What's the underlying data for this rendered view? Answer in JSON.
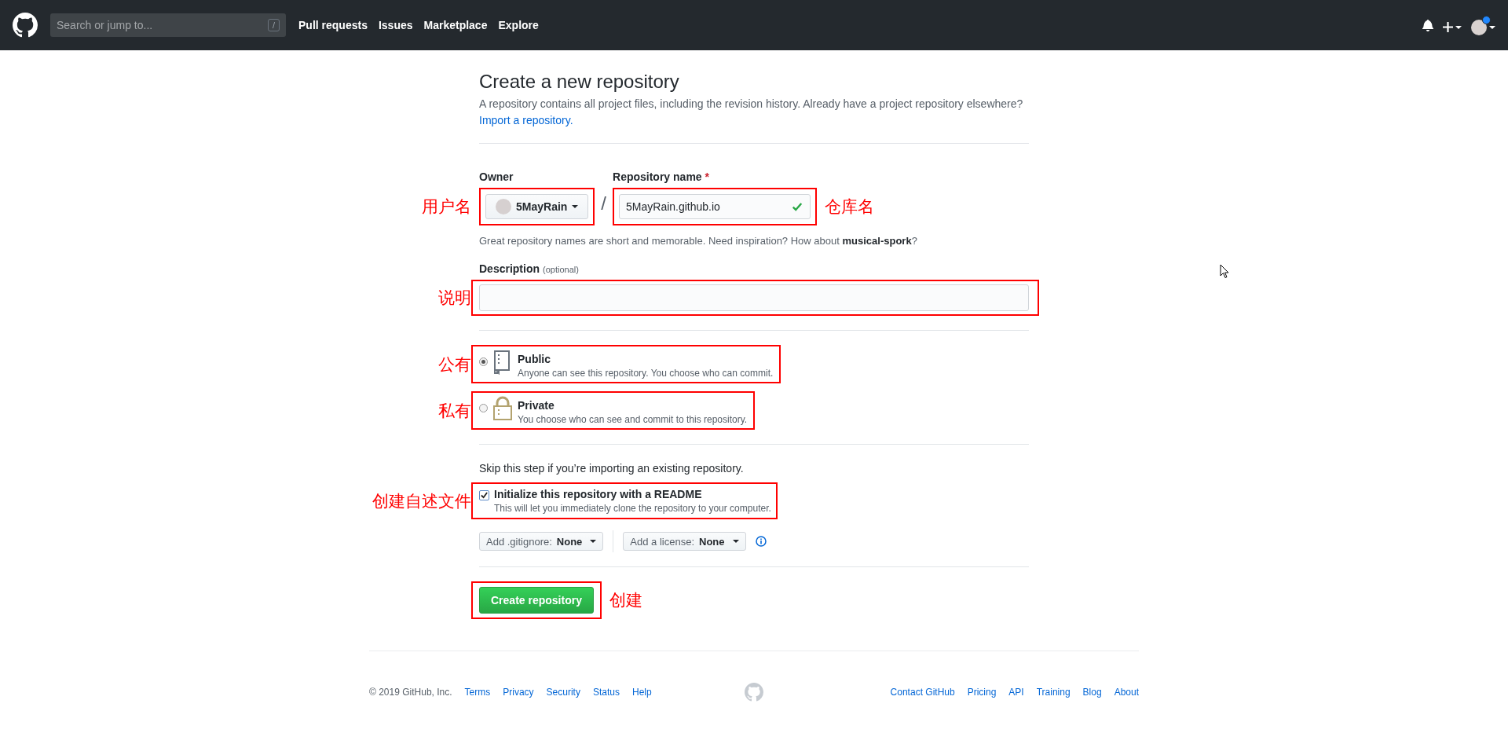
{
  "header": {
    "search": {
      "placeholder": "Search or jump to...",
      "shortcut": "/"
    },
    "nav": [
      "Pull requests",
      "Issues",
      "Marketplace",
      "Explore"
    ]
  },
  "page": {
    "title": "Create a new repository",
    "intro": "A repository contains all project files, including the revision history. Already have a project repository elsewhere?",
    "import_link": "Import a repository."
  },
  "owner": {
    "label": "Owner",
    "value": "5MayRain",
    "annotation": "用户名"
  },
  "owner_separator": "/",
  "repository_name": {
    "label": "Repository name",
    "required_mark": "*",
    "value": "5MayRain.github.io",
    "valid": true,
    "annotation": "仓库名"
  },
  "name_hint": "Great repository names are short and memorable. Need inspiration? How about **musical-spork**?",
  "description": {
    "label": "Description",
    "optional": "(optional)",
    "annotation": "说明"
  },
  "visibility": [
    {
      "kind": "public",
      "title": "Public",
      "text": "Anyone can see this repository. You choose who can commit.",
      "selected": true,
      "annotation": "公有"
    },
    {
      "kind": "private",
      "title": "Private",
      "text": "You choose who can see and commit to this repository.",
      "selected": false,
      "annotation": "私有"
    }
  ],
  "init_hint": "Skip this step if you’re importing an existing repository.",
  "readme": {
    "label": "Initialize this repository with a README",
    "text": "This will let you immediately clone the repository to your computer.",
    "checked": true,
    "annotation": "创建自述文件"
  },
  "gitignore": {
    "label": "Add .gitignore:",
    "value": "None"
  },
  "license": {
    "label": "Add a license:",
    "value": "None"
  },
  "submit": {
    "label": "Create repository",
    "annotation": "创建"
  },
  "footer": {
    "copyright": "© 2019 GitHub, Inc.",
    "left_links": [
      "Terms",
      "Privacy",
      "Security",
      "Status",
      "Help"
    ],
    "right_links": [
      "Contact GitHub",
      "Pricing",
      "API",
      "Training",
      "Blog",
      "About"
    ]
  }
}
